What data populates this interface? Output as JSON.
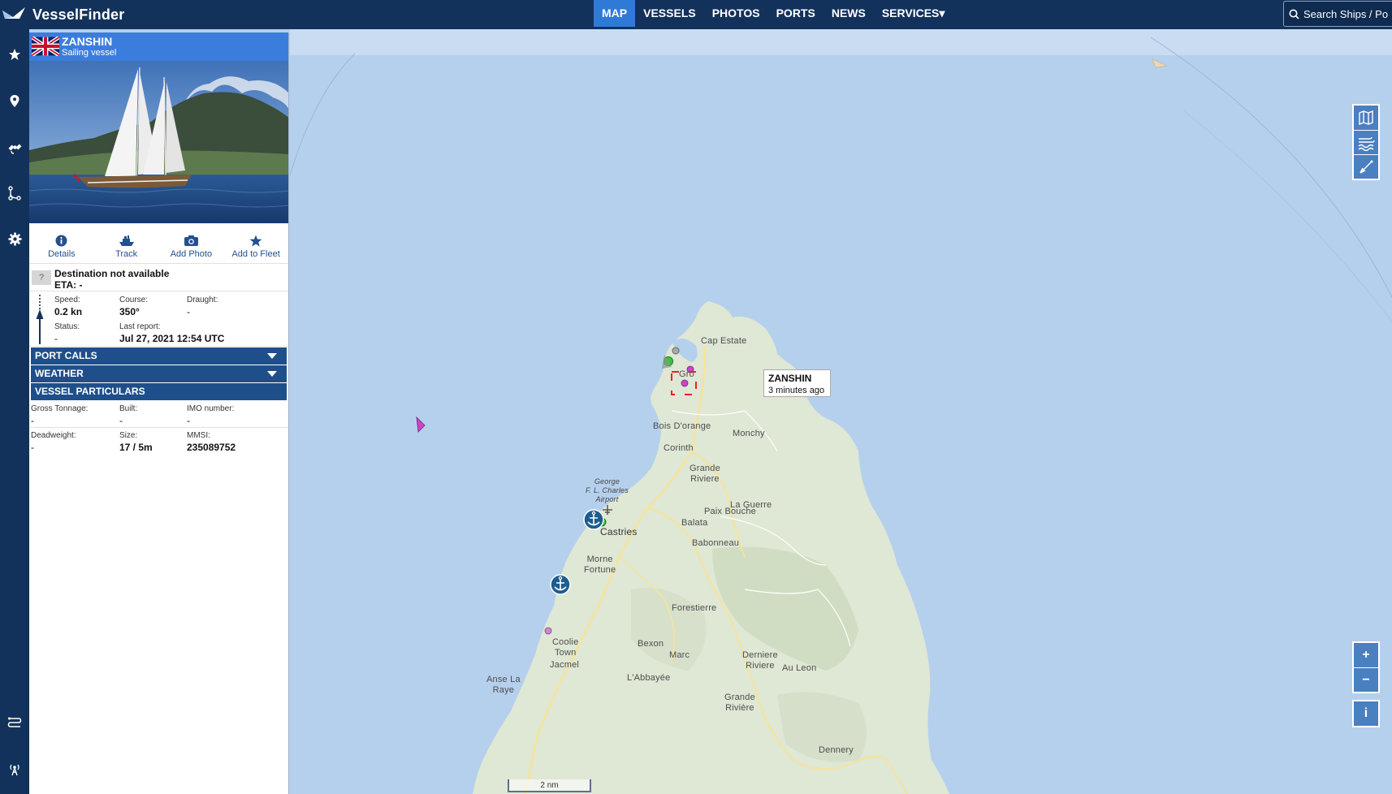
{
  "brand": {
    "name": "VesselFinder"
  },
  "nav": {
    "items": [
      "MAP",
      "VESSELS",
      "PHOTOS",
      "PORTS",
      "NEWS",
      "SERVICES"
    ],
    "active": "MAP",
    "services_caret": "▾"
  },
  "search": {
    "placeholder": "Search Ships  /  Po"
  },
  "rail": {
    "icons": [
      "star-icon",
      "map-pin-icon",
      "satellite-icon",
      "route-icon",
      "gear-icon",
      "route-search-icon",
      "antenna-icon"
    ]
  },
  "vessel": {
    "name": "ZANSHIN",
    "type": "Sailing vessel",
    "flag": "united-kingdom-flag",
    "actions": {
      "details": "Details",
      "track": "Track",
      "add_photo": "Add Photo",
      "add_to_fleet": "Add to Fleet"
    },
    "destination": {
      "icon_label": "?",
      "text": "Destination not available",
      "eta": "ETA: -"
    },
    "voyage": {
      "speed_label": "Speed:",
      "speed": "0.2 kn",
      "course_label": "Course:",
      "course": "350°",
      "draught_label": "Draught:",
      "draught": "-",
      "status_label": "Status:",
      "status": "-",
      "last_report_label": "Last report:",
      "last_report": "Jul 27, 2021 12:54 UTC"
    },
    "sections": {
      "port_calls": "PORT CALLS",
      "weather": "WEATHER",
      "particulars": "VESSEL PARTICULARS"
    },
    "particulars": {
      "gross_tonnage_label": "Gross Tonnage:",
      "gross_tonnage": "-",
      "built_label": "Built:",
      "built": "-",
      "imo_label": "IMO number:",
      "imo": "-",
      "deadweight_label": "Deadweight:",
      "deadweight": "-",
      "size_label": "Size:",
      "size": "17 / 5m",
      "mmsi_label": "MMSI:",
      "mmsi": "235089752"
    }
  },
  "map": {
    "tooltip": {
      "name": "ZANSHIN",
      "age": "3 minutes ago"
    },
    "places": {
      "cap_estate": "Cap Estate",
      "gros_islet": "Gro",
      "bois_dorange": "Bois D'orange",
      "monchy": "Monchy",
      "corinth": "Corinth",
      "grande_riviere_n": "Grande\nRiviere",
      "airport": "George\nF. L. Charles\nAirport",
      "la_guerre": "La Guerre",
      "paix_bouche": "Paix Bouche",
      "balata": "Balata",
      "castries": "Castries",
      "babonneau": "Babonneau",
      "morne_fortune": "Morne\nFortune",
      "forestierre": "Forestierre",
      "coolie_town": "Coolie\nTown",
      "bexon": "Bexon",
      "jacmel": "Jacmel",
      "marc": "Marc",
      "derniere_riviere": "Derniere\nRiviere",
      "au_leon": "Au Leon",
      "anse_la_raye": "Anse La\nRaye",
      "labbayee": "L'Abbayée",
      "grande_riviere_s": "Grande\nRivière",
      "dennery": "Dennery"
    },
    "scale": "2 nm",
    "controls": {
      "zoom_in": "+",
      "zoom_out": "−",
      "info": "i"
    },
    "layer_icons": [
      "map-layers-icon",
      "wind-waves-icon",
      "measure-icon"
    ],
    "colors": {
      "sea": "#b5d0ec",
      "land": "#dfe7d5",
      "port": "#1d5d8f",
      "target": "#cc44cc"
    }
  }
}
